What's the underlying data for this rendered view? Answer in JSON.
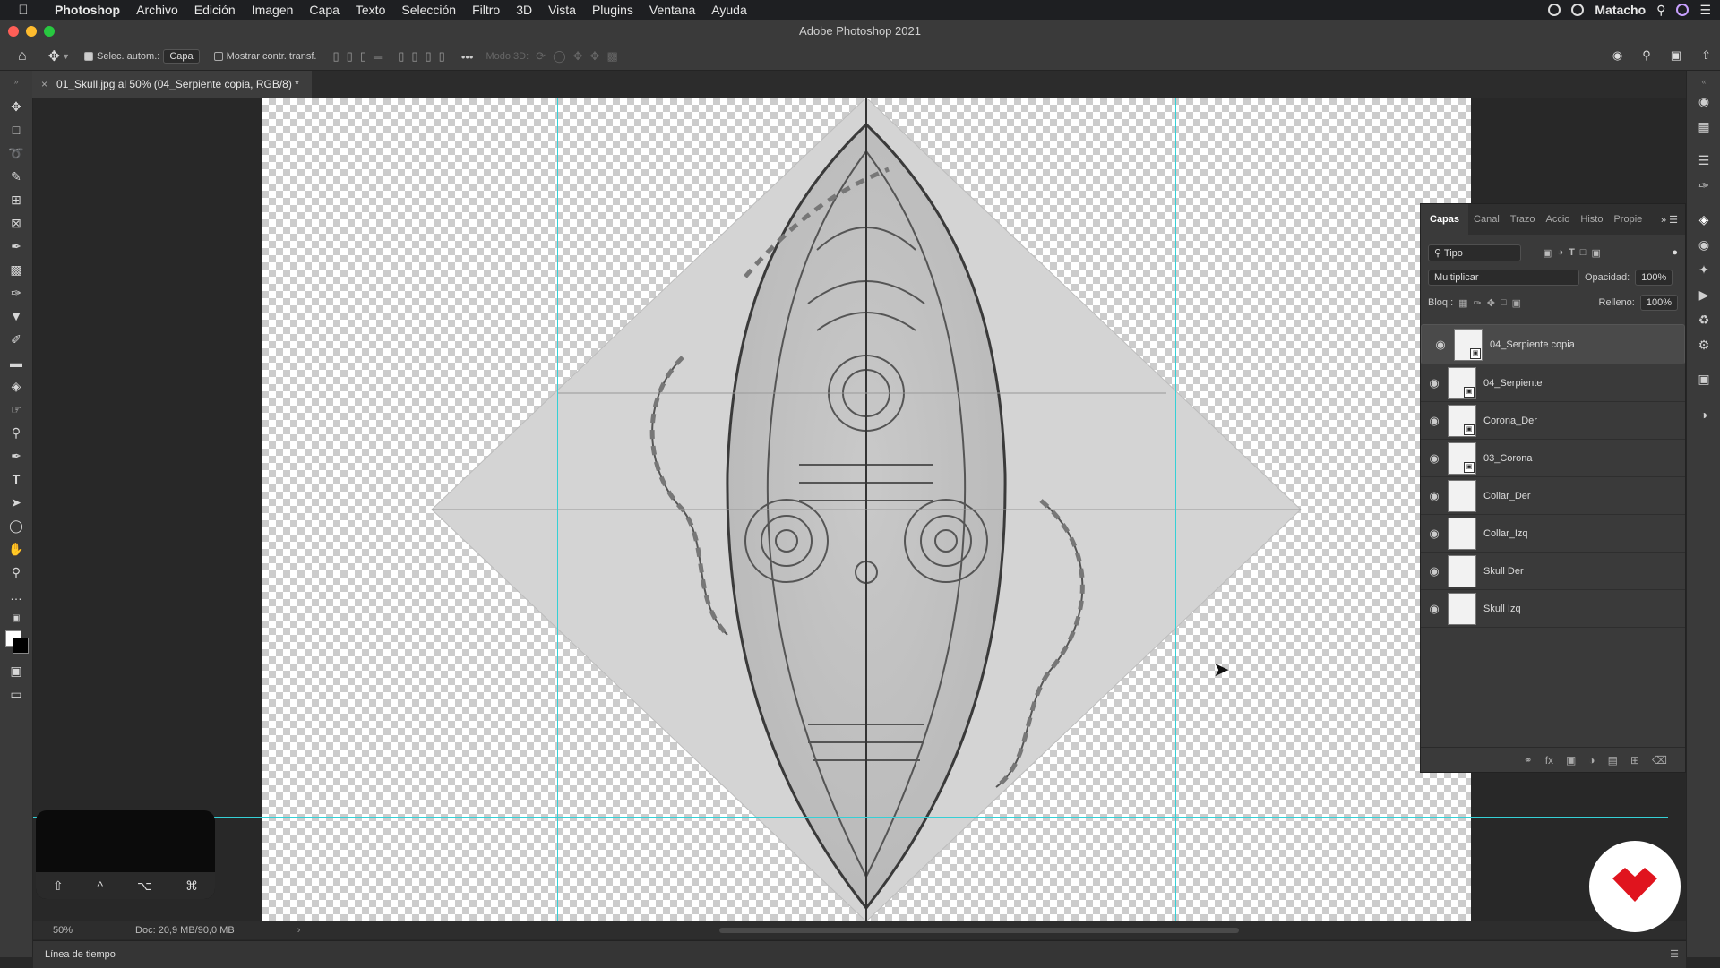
{
  "menubar": {
    "app": "Photoshop",
    "items": [
      "Archivo",
      "Edición",
      "Imagen",
      "Capa",
      "Texto",
      "Selección",
      "Filtro",
      "3D",
      "Vista",
      "Plugins",
      "Ventana",
      "Ayuda"
    ],
    "user": "Matacho"
  },
  "window": {
    "title": "Adobe Photoshop 2021"
  },
  "options": {
    "auto_select_label": "Selec. autom.:",
    "auto_select_value": "Capa",
    "transform_label": "Mostrar contr. transf.",
    "mode3d_label": "Modo 3D:"
  },
  "document": {
    "tab_label": "01_Skull.jpg al 50% (04_Serpiente copia, RGB/8) *"
  },
  "layers_panel": {
    "tabs": [
      "Capas",
      "Canal",
      "Trazo",
      "Accio",
      "Histo",
      "Propie"
    ],
    "filter_value": "Tipo",
    "blend_mode": "Multiplicar",
    "opacity_label": "Opacidad:",
    "opacity_value": "100%",
    "lock_label": "Bloq.:",
    "fill_label": "Relleno:",
    "fill_value": "100%",
    "layers": [
      {
        "name": "04_Serpiente copia",
        "selected": true
      },
      {
        "name": "04_Serpiente",
        "selected": false
      },
      {
        "name": "Corona_Der",
        "selected": false
      },
      {
        "name": "03_Corona",
        "selected": false
      },
      {
        "name": "Collar_Der",
        "selected": false
      },
      {
        "name": "Collar_Izq",
        "selected": false
      },
      {
        "name": "Skull Der",
        "selected": false
      },
      {
        "name": "Skull Izq",
        "selected": false
      }
    ]
  },
  "status": {
    "zoom": "50%",
    "doc_size": "Doc: 20,9 MB/90,0 MB"
  },
  "timeline": {
    "label": "Línea de tiempo"
  },
  "keys": [
    "⇧",
    "^",
    "⌥",
    "⌘"
  ],
  "colors": {
    "guide": "#35d0d6",
    "accent_logo": "#e0141e"
  }
}
